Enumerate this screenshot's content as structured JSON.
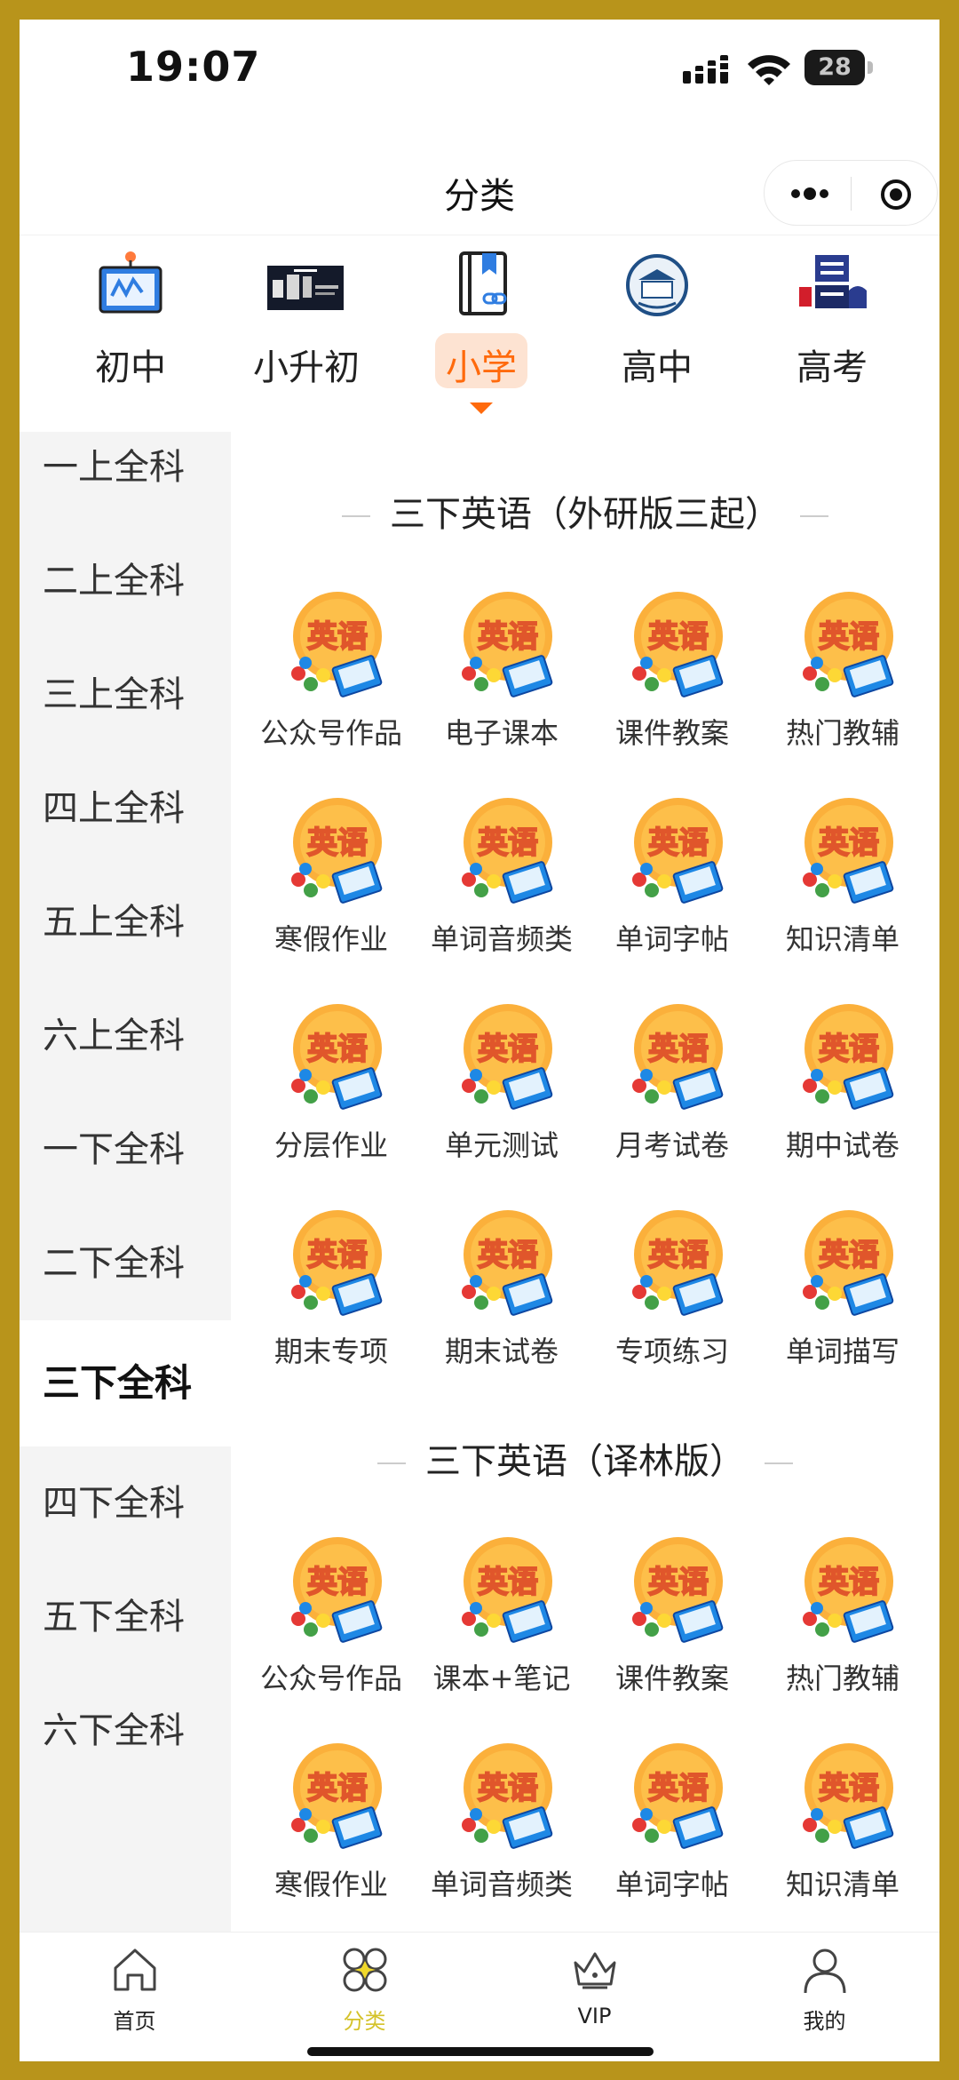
{
  "status_bar": {
    "time": "19:07",
    "battery": "28"
  },
  "nav": {
    "title": "分类",
    "more_icon": "more-dots-icon",
    "close_icon": "target-close-icon"
  },
  "colors": {
    "accent": "#ff6a0c",
    "tab_active": "#d4c22a",
    "sidebar_bg": "#f4f4f4",
    "frame": "#b8941b"
  },
  "levels": [
    {
      "label": "初中",
      "icon": "whiteboard-icon"
    },
    {
      "label": "小升初",
      "icon": "banner-image-icon"
    },
    {
      "label": "小学",
      "icon": "book-link-icon",
      "active": true
    },
    {
      "label": "高中",
      "icon": "school-badge-icon"
    },
    {
      "label": "高考",
      "icon": "gaokao-logo-icon"
    }
  ],
  "sidebar": {
    "items": [
      "一上全科",
      "二上全科",
      "三上全科",
      "四上全科",
      "五上全科",
      "六上全科",
      "一下全科",
      "二下全科",
      "三下全科",
      "四下全科",
      "五下全科",
      "六下全科"
    ],
    "active_index": 8
  },
  "icon_text": "英语",
  "sections": [
    {
      "title": "三下英语（外研版三起）",
      "items": [
        "公众号作品",
        "电子课本",
        "课件教案",
        "热门教辅",
        "寒假作业",
        "单词音频类",
        "单词字帖",
        "知识清单",
        "分层作业",
        "单元测试",
        "月考试卷",
        "期中试卷",
        "期末专项",
        "期末试卷",
        "专项练习",
        "单词描写"
      ]
    },
    {
      "title": "三下英语（译林版）",
      "items": [
        "公众号作品",
        "课本+笔记",
        "课件教案",
        "热门教辅",
        "寒假作业",
        "单词音频类",
        "单词字帖",
        "知识清单"
      ]
    }
  ],
  "tabbar": [
    {
      "label": "首页",
      "icon": "home-icon"
    },
    {
      "label": "分类",
      "icon": "category-icon",
      "active": true
    },
    {
      "label": "VIP",
      "icon": "crown-icon"
    },
    {
      "label": "我的",
      "icon": "user-icon"
    }
  ]
}
